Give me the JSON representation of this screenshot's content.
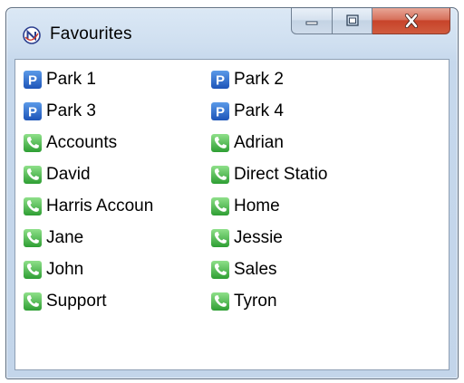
{
  "window": {
    "title": "Favourites",
    "app_icon": "n-logo-icon",
    "buttons": {
      "minimize": "minimize-icon",
      "maximize": "maximize-icon",
      "close": "close-icon"
    }
  },
  "colors": {
    "park_icon_bg": "#2f6fd0",
    "phone_icon_bg": "#3fb83f",
    "close_button": "#c7432a"
  },
  "favourites": {
    "items": [
      {
        "label": "Park 1",
        "icon": "park-icon"
      },
      {
        "label": "Park 2",
        "icon": "park-icon"
      },
      {
        "label": "Park 3",
        "icon": "park-icon"
      },
      {
        "label": "Park 4",
        "icon": "park-icon"
      },
      {
        "label": "Accounts",
        "icon": "phone-icon"
      },
      {
        "label": "Adrian",
        "icon": "phone-icon"
      },
      {
        "label": "David",
        "icon": "phone-icon"
      },
      {
        "label": "Direct Statio",
        "icon": "phone-icon"
      },
      {
        "label": "Harris Accoun",
        "icon": "phone-icon"
      },
      {
        "label": "Home",
        "icon": "phone-icon"
      },
      {
        "label": "Jane",
        "icon": "phone-icon"
      },
      {
        "label": "Jessie",
        "icon": "phone-icon"
      },
      {
        "label": "John",
        "icon": "phone-icon"
      },
      {
        "label": "Sales",
        "icon": "phone-icon"
      },
      {
        "label": "Support",
        "icon": "phone-icon"
      },
      {
        "label": "Tyron",
        "icon": "phone-icon"
      }
    ]
  }
}
